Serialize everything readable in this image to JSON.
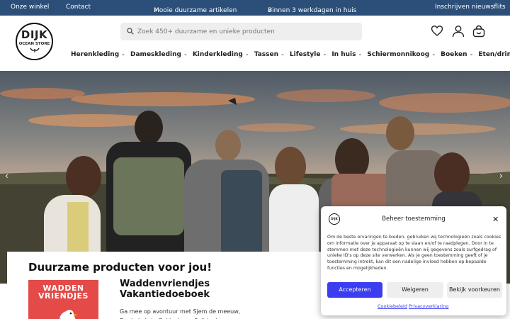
{
  "topbar": {
    "store": "Onze winkel",
    "contact": "Contact",
    "usp1": "Mooie duurzame artikelen",
    "usp2": "Binnen 3 werkdagen in huis",
    "newsletter": "Inschrijven nieuwsflits"
  },
  "logo": {
    "name": "DIJK",
    "sub": "OCEAN STORE"
  },
  "search": {
    "placeholder": "Zoek 450+ duurzame en unieke producten"
  },
  "header_icons": [
    "heart-icon",
    "user-icon",
    "cart-icon"
  ],
  "nav": [
    "Herenkleding",
    "Dameskleding",
    "Kinderkleding",
    "Tassen",
    "Lifestyle",
    "In huis",
    "Schiermonnikoog",
    "Boeken",
    "Eten/drinken"
  ],
  "hero": {
    "prev": "‹",
    "next": "›"
  },
  "section": {
    "heading": "Duurzame producten voor jou!",
    "product_title": "Waddenvriendjes Vakantiedoeboek",
    "product_desc": "Ga mee op avontuur met Sjem de meeuw, Dook de Lyh, Gekke Lees, Saltdoei",
    "book_cover": "WADDEN VRIENDJES"
  },
  "consent": {
    "title": "Beheer toestemming",
    "text": "Om de beste ervaringen te bieden, gebruiken wij technologieën zoals cookies om informatie over je apparaat op te slaan en/of te raadplegen. Door in te stemmen met deze technologieën kunnen wij gegevens zoals surfgedrag of unieke ID's op deze site verwerken. Als je geen toestemming geeft of je toestemming intrekt, kan dit een nadelige invloed hebben op bepaalde functies en mogelijkheden.",
    "accept": "Accepteren",
    "deny": "Weigeren",
    "prefs": "Bekijk voorkeuren",
    "cookie_policy": "Cookiebeleid",
    "privacy": "Privacyverklaring"
  },
  "colors": {
    "topbar": "#2b4f78",
    "accent": "#3c3df0",
    "book": "#e34a48"
  }
}
